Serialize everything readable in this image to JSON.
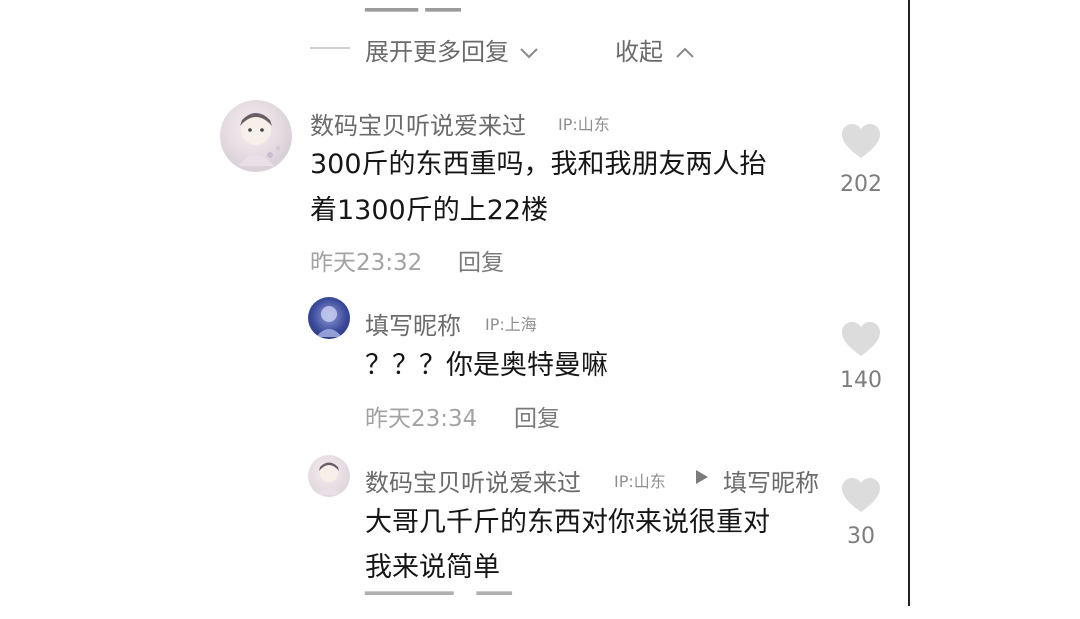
{
  "thread": {
    "expand_label": "展开更多回复",
    "collapse_label": "收起"
  },
  "comments": [
    {
      "username": "数码宝贝听说爱来过",
      "ip": "IP:山东",
      "text_line1": "300斤的东西重吗，我和我朋友两人抬",
      "text_line2": "着1300斤的上22楼",
      "time": "昨天23:32",
      "reply_label": "回复",
      "likes": "202"
    },
    {
      "username": "填写昵称",
      "ip": "IP:上海",
      "text_line1": "？？？你是奥特曼嘛",
      "time": "昨天23:34",
      "reply_label": "回复",
      "likes": "140"
    },
    {
      "username": "数码宝贝听说爱来过",
      "ip": "IP:山东",
      "reply_to": "填写昵称",
      "text_line1": "大哥几千斤的东西对你来说很重对",
      "text_line2": "我来说简单",
      "likes": "30"
    }
  ],
  "icons": {
    "expand": "chevron-down-icon",
    "collapse": "chevron-up-icon",
    "like": "heart-icon",
    "reply_arrow": "play-triangle-icon"
  },
  "colors": {
    "text": "#161616",
    "muted": "#8a8a8a",
    "heart": "#d9d9d9"
  }
}
